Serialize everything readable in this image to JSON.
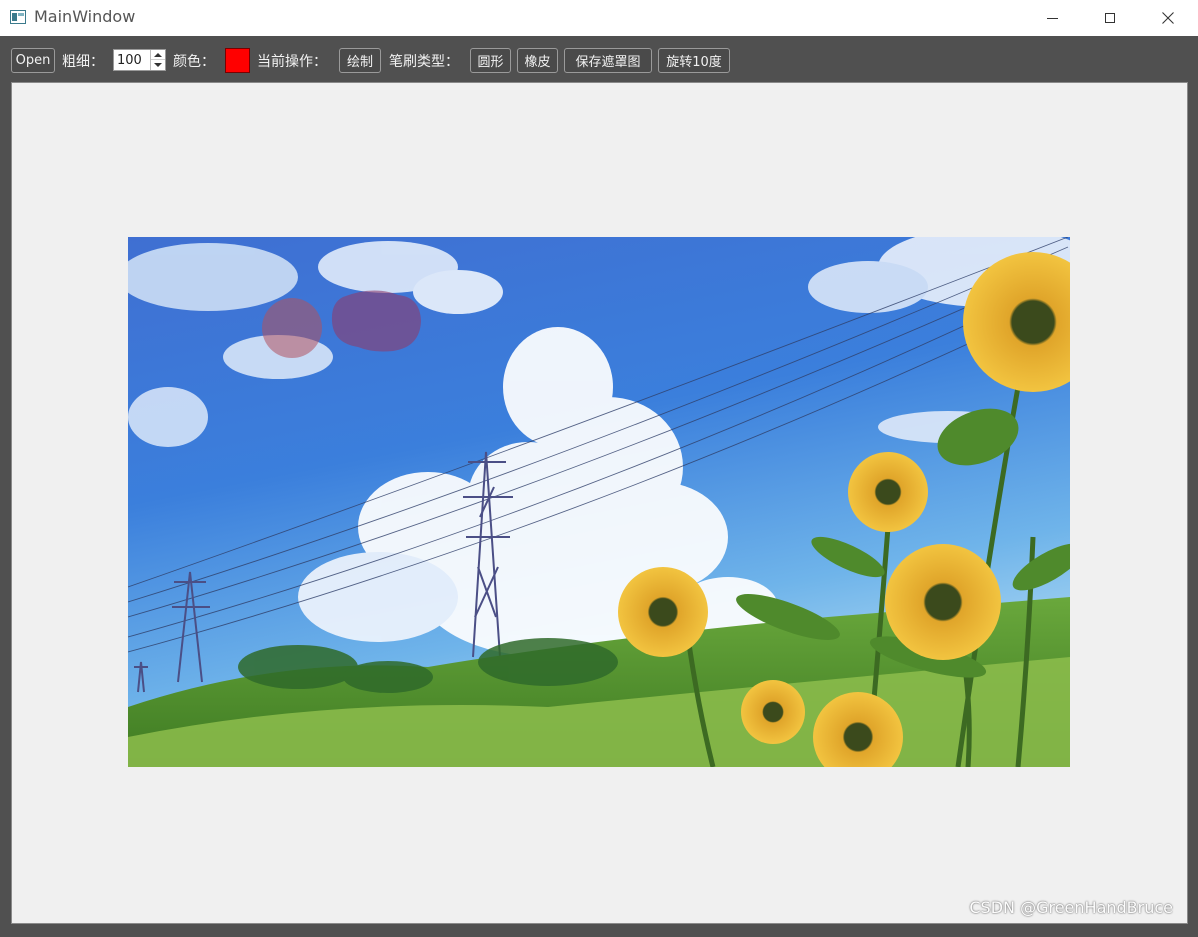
{
  "window": {
    "title": "MainWindow",
    "controls": [
      "minimize",
      "maximize",
      "close"
    ]
  },
  "toolbar": {
    "open_label": "Open",
    "thickness_label": "粗细：",
    "thickness_value": "100",
    "color_label": "颜色：",
    "color_value": "#ff0000",
    "current_op_label": "当前操作：",
    "current_op_value": "绘制",
    "brush_type_label": "笔刷类型：",
    "brush_circle": "圆形",
    "brush_eraser": "橡皮",
    "save_mask": "保存遮罩图",
    "rotate": "旋转10度"
  },
  "canvas": {
    "brush_marks": [
      {
        "shape": "circle",
        "color": "#b0525f",
        "opacity": 0.55
      },
      {
        "shape": "blob",
        "color": "#8c3c6e",
        "opacity": 0.6
      }
    ]
  },
  "watermark": "CSDN @GreenHandBruce"
}
